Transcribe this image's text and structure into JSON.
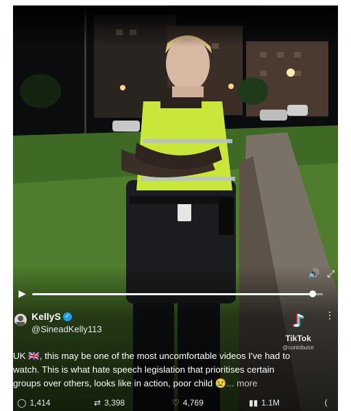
{
  "post": {
    "author_name": "KellyS",
    "author_handle": "@SineadKelly113",
    "text_lines": [
      "UK 🇬🇧, this may be one of the most uncomfortable videos I've had to",
      "watch. This is what hate speech legislation that prioritises certain",
      "groups over others, looks like in action, poor child"
    ],
    "emoji": "😢",
    "more_label": "... more",
    "replies": "1,414",
    "reposts": "3,398",
    "likes": "4,769",
    "views": "1.1M"
  },
  "video": {
    "watermark_label": "TikTok",
    "watermark_user": "@contributor",
    "progress_fraction": 0.965
  },
  "icons": {
    "play": "play-icon",
    "volume": "volume-icon",
    "expand": "expand-icon",
    "reply": "reply-icon",
    "repost": "repost-icon",
    "like": "like-icon",
    "views": "views-icon",
    "share": "share-icon",
    "more": "more-icon",
    "verified": "verified-badge-icon"
  },
  "colors": {
    "verified": "#1d9bf0",
    "vest": "#c9e63a"
  }
}
